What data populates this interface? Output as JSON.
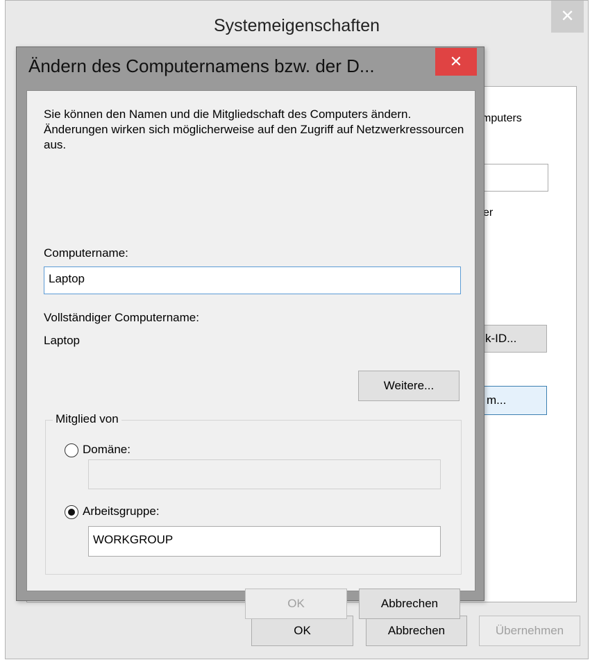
{
  "back_window": {
    "title": "Systemeigenschaften",
    "close_glyph": "✕",
    "fragments": {
      "computers": "mputers",
      "er": "er",
      "network_id_btn": "k-ID...",
      "change_btn": "m..."
    },
    "buttons": {
      "ok": "OK",
      "cancel": "Abbrechen",
      "apply": "Übernehmen"
    }
  },
  "dialog": {
    "title": "Ändern des Computernamens bzw. der D...",
    "close_glyph": "✕",
    "description": "Sie können den Namen und die Mitgliedschaft des Computers ändern. Änderungen wirken sich möglicherweise auf den Zugriff auf Netzwerkressourcen aus.",
    "computer_name_label": "Computername:",
    "computer_name_value": "Laptop",
    "full_name_label": "Vollständiger Computername:",
    "full_name_value": "Laptop",
    "more_button": "Weitere...",
    "member_of": {
      "legend": "Mitglied von",
      "domain_label": "Domäne:",
      "domain_value": "",
      "domain_selected": false,
      "workgroup_label": "Arbeitsgruppe:",
      "workgroup_value": "WORKGROUP",
      "workgroup_selected": true
    },
    "ok_button": "OK",
    "cancel_button": "Abbrechen"
  },
  "colors": {
    "close_active": "#e04343",
    "close_inactive": "#cdcdcd",
    "focus_border": "#3c7fb1",
    "dialog_frame": "#9a9a9a"
  }
}
